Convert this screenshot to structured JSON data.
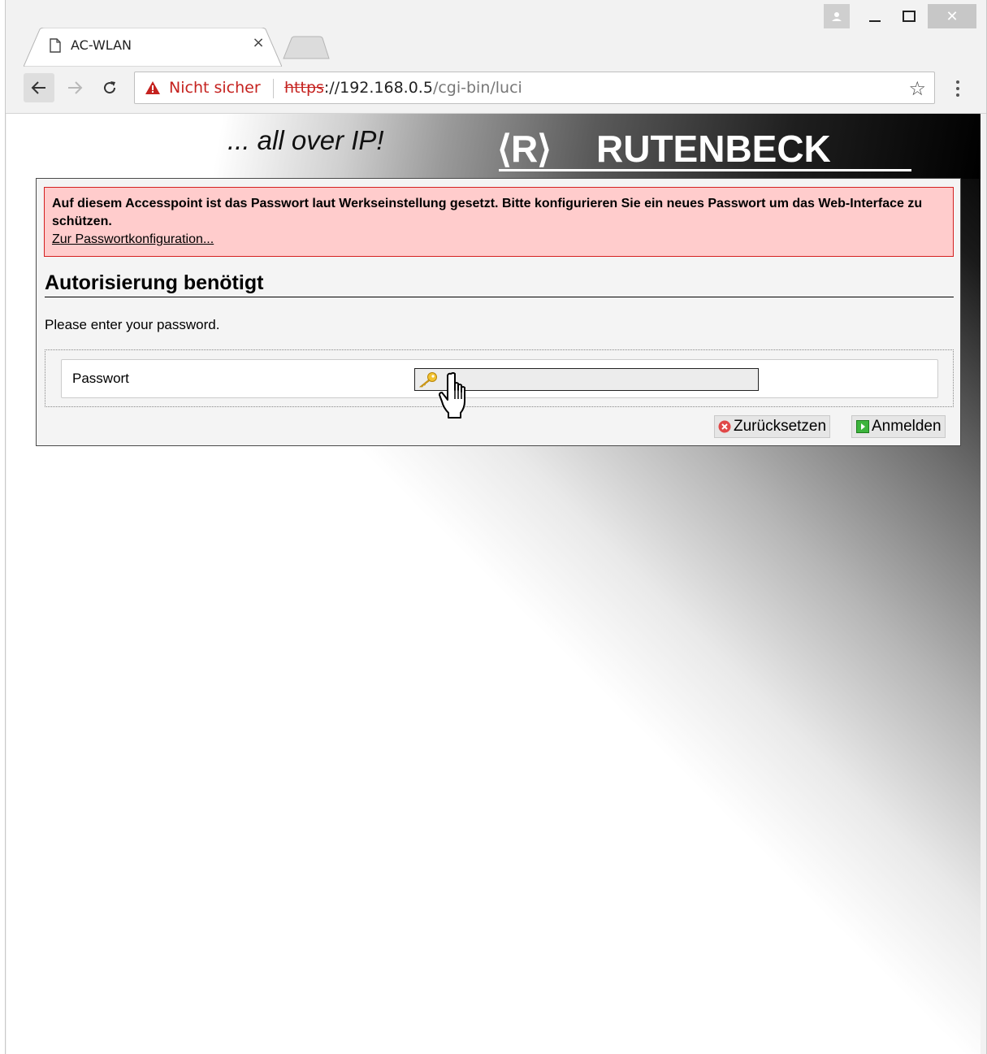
{
  "browser": {
    "tab": {
      "title": "AC-WLAN",
      "close_glyph": "×",
      "favicon": "page-icon"
    },
    "window_controls": {
      "close_glyph": "✕"
    },
    "address_bar": {
      "security_label": "Nicht sicher",
      "url_scheme": "https",
      "url_host": "://192.168.0.5",
      "url_path": "/cgi-bin/luci",
      "bookmark_glyph": "☆"
    }
  },
  "header": {
    "slogan": "... all over IP!",
    "logo_mark": "⟨R⟩",
    "logo_text": "RUTENBECK"
  },
  "alert": {
    "message": "Auf diesem Accesspoint ist das Passwort laut Werkseinstellung gesetzt. Bitte konfigurieren Sie ein neues Passwort um das Web-Interface zu schützen.",
    "link_text": "Zur Passwortkonfiguration..."
  },
  "login": {
    "title": "Autorisierung benötigt",
    "instruction": "Please enter your password.",
    "password_label": "Passwort",
    "password_value": "",
    "reset_label": "Zurücksetzen",
    "submit_label": "Anmelden"
  },
  "colors": {
    "alert_background": "#ffcccc",
    "alert_border": "#d42020",
    "insecure_red": "#c5221f"
  }
}
